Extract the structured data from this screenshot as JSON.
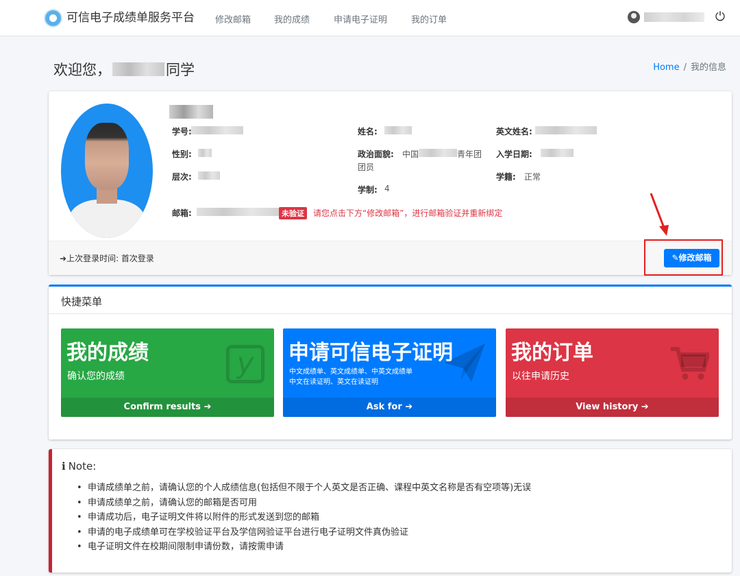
{
  "navbar": {
    "brand": "可信电子成绩单服务平台",
    "links": [
      "修改邮箱",
      "我的成绩",
      "申请电子证明",
      "我的订单"
    ],
    "power_icon": "power-icon",
    "user_icon": "user-circle-icon"
  },
  "header": {
    "greeting_prefix": "欢迎您，",
    "greeting_suffix": "同学",
    "breadcrumb_home": "Home",
    "breadcrumb_sep": "/",
    "breadcrumb_current": "我的信息"
  },
  "profile": {
    "student_id_label": "学号:",
    "gender_label": "性别:",
    "level_label": "层次:",
    "name_label": "姓名:",
    "political_label": "政治面貌:",
    "political_value_a": "中国",
    "political_value_b": "青年团",
    "political_value_c": "团员",
    "duration_label": "学制:",
    "duration_value": "4",
    "english_name_label": "英文姓名:",
    "enroll_label": "入学日期:",
    "status_label": "学籍:",
    "status_value": "正常",
    "email_label": "邮箱:",
    "unverified_badge": "未验证",
    "email_warning": "请您点击下方“修改邮箱”，进行邮箱验证并重新绑定",
    "last_login_icon": "sign-in-icon",
    "last_login": "上次登录时间: 首次登录",
    "edit_email_button": "修改邮箱",
    "edit_icon": "pencil-icon"
  },
  "quick_menu": {
    "title": "快捷菜单",
    "tiles": [
      {
        "title": "我的成绩",
        "subtitle": "确认您的成绩",
        "footer": "Confirm results",
        "icon": "yoast-y-icon",
        "color": "#28a745"
      },
      {
        "title": "申请可信电子证明",
        "subtitle_line1": "中文成绩单、英文成绩单、中英文成绩单",
        "subtitle_line2": "中文在读证明、英文在读证明",
        "footer": "Ask for",
        "icon": "paper-plane-icon",
        "color": "#007bff"
      },
      {
        "title": "我的订单",
        "subtitle": "以往申请历史",
        "footer": "View history",
        "icon": "shopping-cart-icon",
        "color": "#dc3545"
      }
    ],
    "footer_arrow_icon": "arrow-circle-right-icon"
  },
  "note": {
    "icon": "info-icon",
    "title": "Note:",
    "items": [
      "申请成绩单之前，请确认您的个人成绩信息(包括但不限于个人英文是否正确、课程中英文名称是否有空项等)无误",
      "申请成绩单之前，请确认您的邮箱是否可用",
      "申请成功后，电子证明文件将以附件的形式发送到您的邮箱",
      "申请的电子成绩单可在学校验证平台及学信网验证平台进行电子证明文件真伪验证",
      "电子证明文件在校期间限制申请份数，请按需申请"
    ]
  }
}
